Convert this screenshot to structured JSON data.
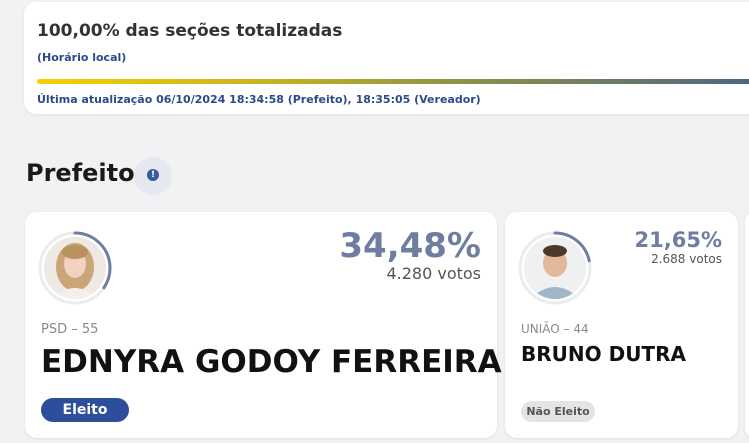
{
  "status": {
    "title": "100,00% das seções totalizadas",
    "local_time": "(Horário local)",
    "progress_percent": 100,
    "last_update": "Última atualização 06/10/2024 18:34:58 (Prefeito), 18:35:05 (Vereador)"
  },
  "section": {
    "title": "Prefeito",
    "info_icon": "!"
  },
  "candidates": [
    {
      "percent": "34,48%",
      "votes": "4.280 votos",
      "party": "PSD – 55",
      "name": "EDNYRA GODOY FERREIRA",
      "status": "Eleito",
      "ring_fraction": 0.3448
    },
    {
      "percent": "21,65%",
      "votes": "2.688 votos",
      "party": "UNIÃO – 44",
      "name": "BRUNO DUTRA",
      "status": "Não Eleito",
      "ring_fraction": 0.2165
    }
  ],
  "colors": {
    "accent": "#2d4e9a",
    "percent_text": "#6f7ea0",
    "ring": "#6f7ea0"
  }
}
